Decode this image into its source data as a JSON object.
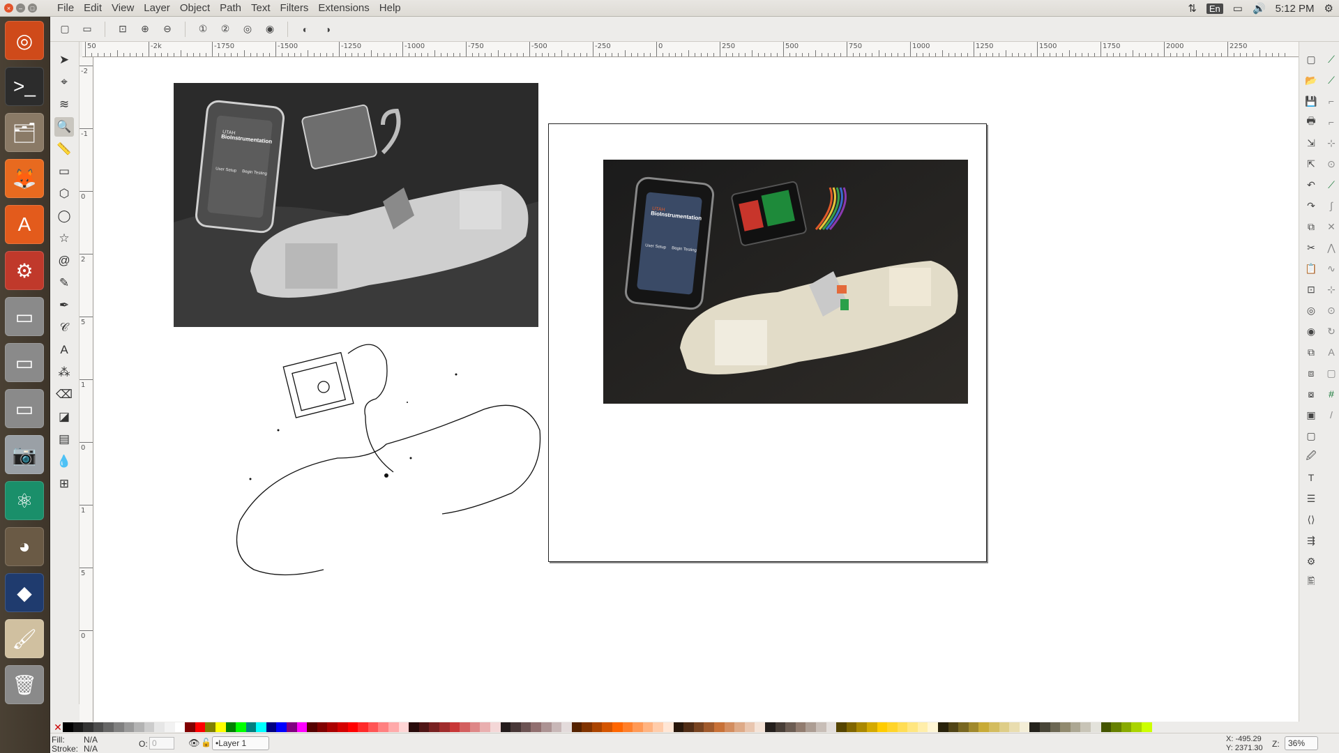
{
  "menubar": {
    "items": [
      "File",
      "Edit",
      "View",
      "Layer",
      "Object",
      "Path",
      "Text",
      "Filters",
      "Extensions",
      "Help"
    ],
    "tray": {
      "lang": "En",
      "time": "5:12 PM"
    }
  },
  "launcher": {
    "items": [
      "ubuntu-dash-icon",
      "terminal-icon",
      "file-manager-icon",
      "firefox-icon",
      "software-center-icon",
      "system-settings-icon",
      "drive-icon",
      "drive-icon",
      "drive-icon",
      "camera-icon",
      "atom-icon",
      "gimp-icon",
      "inkscape-icon",
      "draw-icon",
      "trash-icon"
    ]
  },
  "ruler": {
    "h_labels": [
      "50",
      "-2k",
      "-1750",
      "-1500",
      "-1250",
      "-1000",
      "-750",
      "-500",
      "-250",
      "0",
      "250",
      "500",
      "750",
      "1000",
      "1250",
      "1500",
      "1750",
      "2000",
      "2250"
    ],
    "v_labels": [
      "-2",
      "-1",
      "0",
      "2",
      "5",
      "1",
      "0",
      "1",
      "5",
      "0"
    ]
  },
  "canvas": {
    "phone_header": "UTAH",
    "phone_title": "BioInstrumentation",
    "phone_btn1": "User Setup",
    "phone_btn2": "Begin Testing"
  },
  "status": {
    "fill_label": "Fill:",
    "fill_value": "N/A",
    "stroke_label": "Stroke:",
    "stroke_value": "N/A",
    "opacity_label": "O:",
    "opacity_value": "0",
    "layer": "•Layer 1",
    "coords_x": "X: -495.29",
    "coords_y": "Y: 2371.30",
    "zoom_label": "Z:",
    "zoom_value": "36%"
  },
  "palette": [
    "#000000",
    "#1a1a1a",
    "#333333",
    "#4d4d4d",
    "#666666",
    "#808080",
    "#999999",
    "#b3b3b3",
    "#cccccc",
    "#e6e6e6",
    "#f2f2f2",
    "#ffffff",
    "#800000",
    "#ff0000",
    "#808000",
    "#ffff00",
    "#008000",
    "#00ff00",
    "#008080",
    "#00ffff",
    "#000080",
    "#0000ff",
    "#800080",
    "#ff00ff",
    "#550000",
    "#800000",
    "#aa0000",
    "#d40000",
    "#ff0000",
    "#ff2a2a",
    "#ff5555",
    "#ff8080",
    "#ffaaaa",
    "#ffd5d5",
    "#280b0b",
    "#501616",
    "#782121",
    "#a02c2c",
    "#c83737",
    "#d35f5f",
    "#de8787",
    "#e9afaf",
    "#f4d7d7",
    "#241c1c",
    "#483737",
    "#6c5353",
    "#916f6f",
    "#ac9393",
    "#c8b7b7",
    "#e3dbdb",
    "#552200",
    "#803300",
    "#aa4400",
    "#d45500",
    "#ff6600",
    "#ff7f2a",
    "#ff9955",
    "#ffb380",
    "#ffccaa",
    "#ffe6d5",
    "#28170b",
    "#502d16",
    "#784421",
    "#a05a2c",
    "#c87137",
    "#d38d5f",
    "#deaa87",
    "#e9c6af",
    "#f4e3d7",
    "#241f1c",
    "#483e37",
    "#6c5d53",
    "#917c6f",
    "#ac9d93",
    "#c8beb7",
    "#e3dedb",
    "#554400",
    "#806600",
    "#aa8800",
    "#d4aa00",
    "#ffcc00",
    "#ffd42a",
    "#ffdd55",
    "#ffe680",
    "#ffeeaa",
    "#fff6d5",
    "#28220b",
    "#504416",
    "#786721",
    "#a0892c",
    "#c8ab37",
    "#d3bc5f",
    "#decd87",
    "#e9ddaf",
    "#f4eed7",
    "#24221c",
    "#484537",
    "#6c6753",
    "#918a6f",
    "#aca793",
    "#c8c4b7",
    "#e3e2db",
    "#445500",
    "#668000",
    "#88aa00",
    "#aad400",
    "#ccff00"
  ]
}
